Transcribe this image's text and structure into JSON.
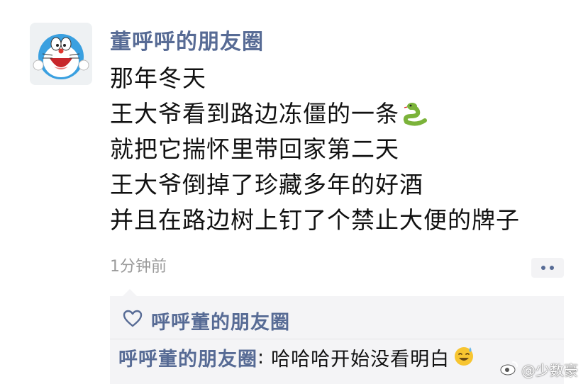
{
  "post": {
    "author": "董呼呼的朋友圈",
    "lines": [
      "那年冬天",
      "王大爷看到路边冻僵的一条",
      "就把它揣怀里带回家第二天",
      "王大爷倒掉了珍藏多年的好酒",
      "并且在路边树上钉了个禁止大便的牌子"
    ],
    "inline_emoji": "snake-emoji",
    "time": "1分钟前"
  },
  "comments": {
    "like_icon": "heart-outline-icon",
    "likers": "呼呼董的朋友圈",
    "items": [
      {
        "author": "呼呼董的朋友圈",
        "separator": ":",
        "text": "哈哈哈开始没看明白",
        "emoji": "sweat-smile-emoji"
      }
    ]
  },
  "watermark": {
    "text": "@少数豪",
    "logo": "weibo-icon"
  },
  "colors": {
    "name_blue": "#576b95",
    "text": "#111111",
    "muted": "#9a9a9a",
    "comment_bg": "#f4f4f6"
  }
}
